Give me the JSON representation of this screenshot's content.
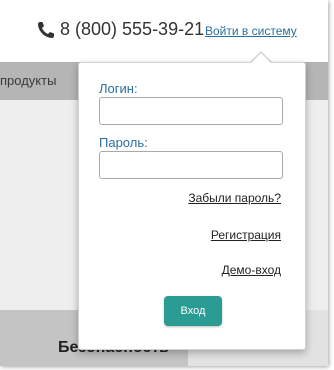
{
  "header": {
    "phone_icon": "phone-icon",
    "phone": "8 (800) 555-39-21",
    "login_link": "Войти в систему"
  },
  "nav": {
    "item": "продукты"
  },
  "content": {
    "heading": "Безопасность"
  },
  "login_popup": {
    "login_label": "Логин:",
    "login_value": "",
    "password_label": "Пароль:",
    "password_value": "",
    "forgot_link": "Забыли пароль?",
    "register_link": "Регистрация",
    "demo_link": "Демо-вход",
    "submit_label": "Вход"
  },
  "colors": {
    "link": "#2a6f9e",
    "button": "#2a9c93",
    "navbar": "#b5b5b5"
  }
}
